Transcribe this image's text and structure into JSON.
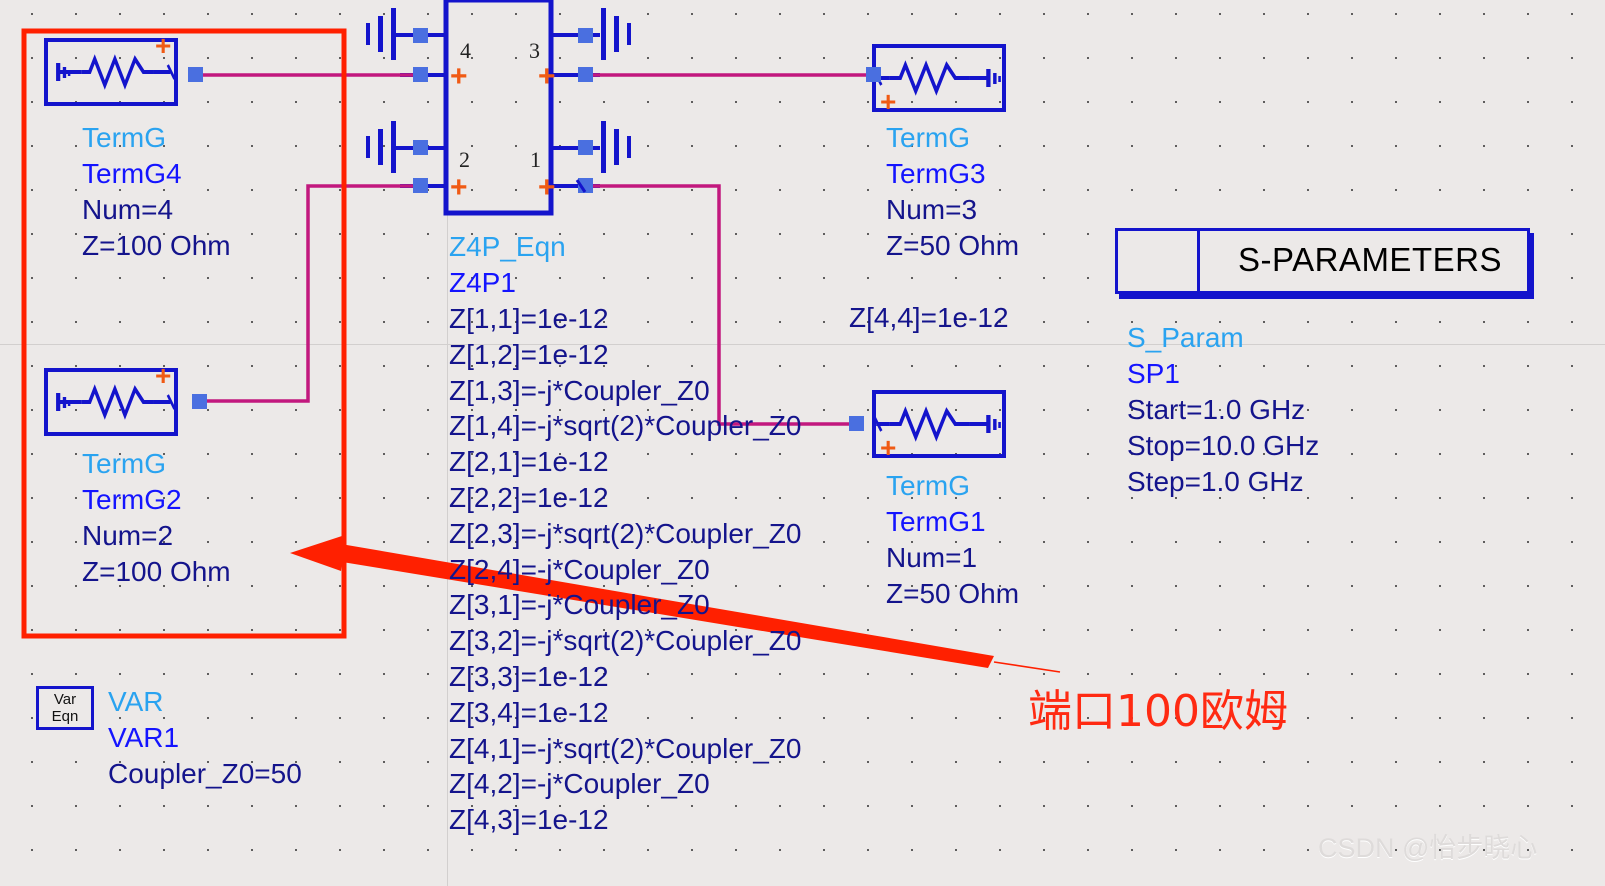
{
  "canvas": {
    "background": "#ece9e8",
    "grid_color": "#3a3a3a",
    "axis_color": "#d2cfce"
  },
  "palette": {
    "wire_blue": "#1414cc",
    "wire_magenta": "#c2187e",
    "pin_blue": "#4a6fe0",
    "plus_orange": "#f05a14",
    "label_cyan": "#2aa3f0",
    "label_blue": "#1414ff",
    "param_navy": "#14148c",
    "annotation_red": "#ff2a12",
    "highlight_red": "#ff2000"
  },
  "components": {
    "term_g4": {
      "type_label": "TermG",
      "instance": "TermG4",
      "num": "Num=4",
      "z": "Z=100 Ohm",
      "plus": "+"
    },
    "term_g2": {
      "type_label": "TermG",
      "instance": "TermG2",
      "num": "Num=2",
      "z": "Z=100 Ohm",
      "plus": "+"
    },
    "term_g3": {
      "type_label": "TermG",
      "instance": "TermG3",
      "num": "Num=3",
      "z": "Z=50 Ohm",
      "plus": "+"
    },
    "term_g1": {
      "type_label": "TermG",
      "instance": "TermG1",
      "num": "Num=1",
      "z": "Z=50 Ohm",
      "plus": "+"
    },
    "z4p": {
      "type_label": "Z4P_Eqn",
      "instance": "Z4P1",
      "port_labels": {
        "p1": "1",
        "p2": "2",
        "p3": "3",
        "p4": "4"
      },
      "plus": "+",
      "equations": [
        "Z[1,1]=1e-12",
        "Z[1,2]=1e-12",
        "Z[1,3]=-j*Coupler_Z0",
        "Z[1,4]=-j*sqrt(2)*Coupler_Z0",
        "Z[2,1]=1e-12",
        "Z[2,2]=1e-12",
        "Z[2,3]=-j*sqrt(2)*Coupler_Z0",
        "Z[2,4]=-j*Coupler_Z0",
        "Z[3,1]=-j*Coupler_Z0",
        "Z[3,2]=-j*sqrt(2)*Coupler_Z0",
        "Z[3,3]=1e-12",
        "Z[3,4]=1e-12",
        "Z[4,1]=-j*sqrt(2)*Coupler_Z0",
        "Z[4,2]=-j*Coupler_Z0",
        "Z[4,3]=1e-12"
      ],
      "equation_extra": "Z[4,4]=1e-12"
    },
    "s_param": {
      "banner_title": "S-PARAMETERS",
      "type_label": "S_Param",
      "instance": "SP1",
      "start": "Start=1.0 GHz",
      "stop": "Stop=10.0 GHz",
      "step": "Step=1.0 GHz"
    },
    "var": {
      "icon_line1": "Var",
      "icon_line2": "Eqn",
      "type_label": "VAR",
      "instance": "VAR1",
      "equation": "Coupler_Z0=50"
    }
  },
  "annotations": {
    "callout_text": "端口100欧姆",
    "highlight_box": "red-selection-rectangle",
    "arrow": "red-arrow-pointing-left"
  },
  "watermark": {
    "text": "CSDN @怡步晓心"
  }
}
